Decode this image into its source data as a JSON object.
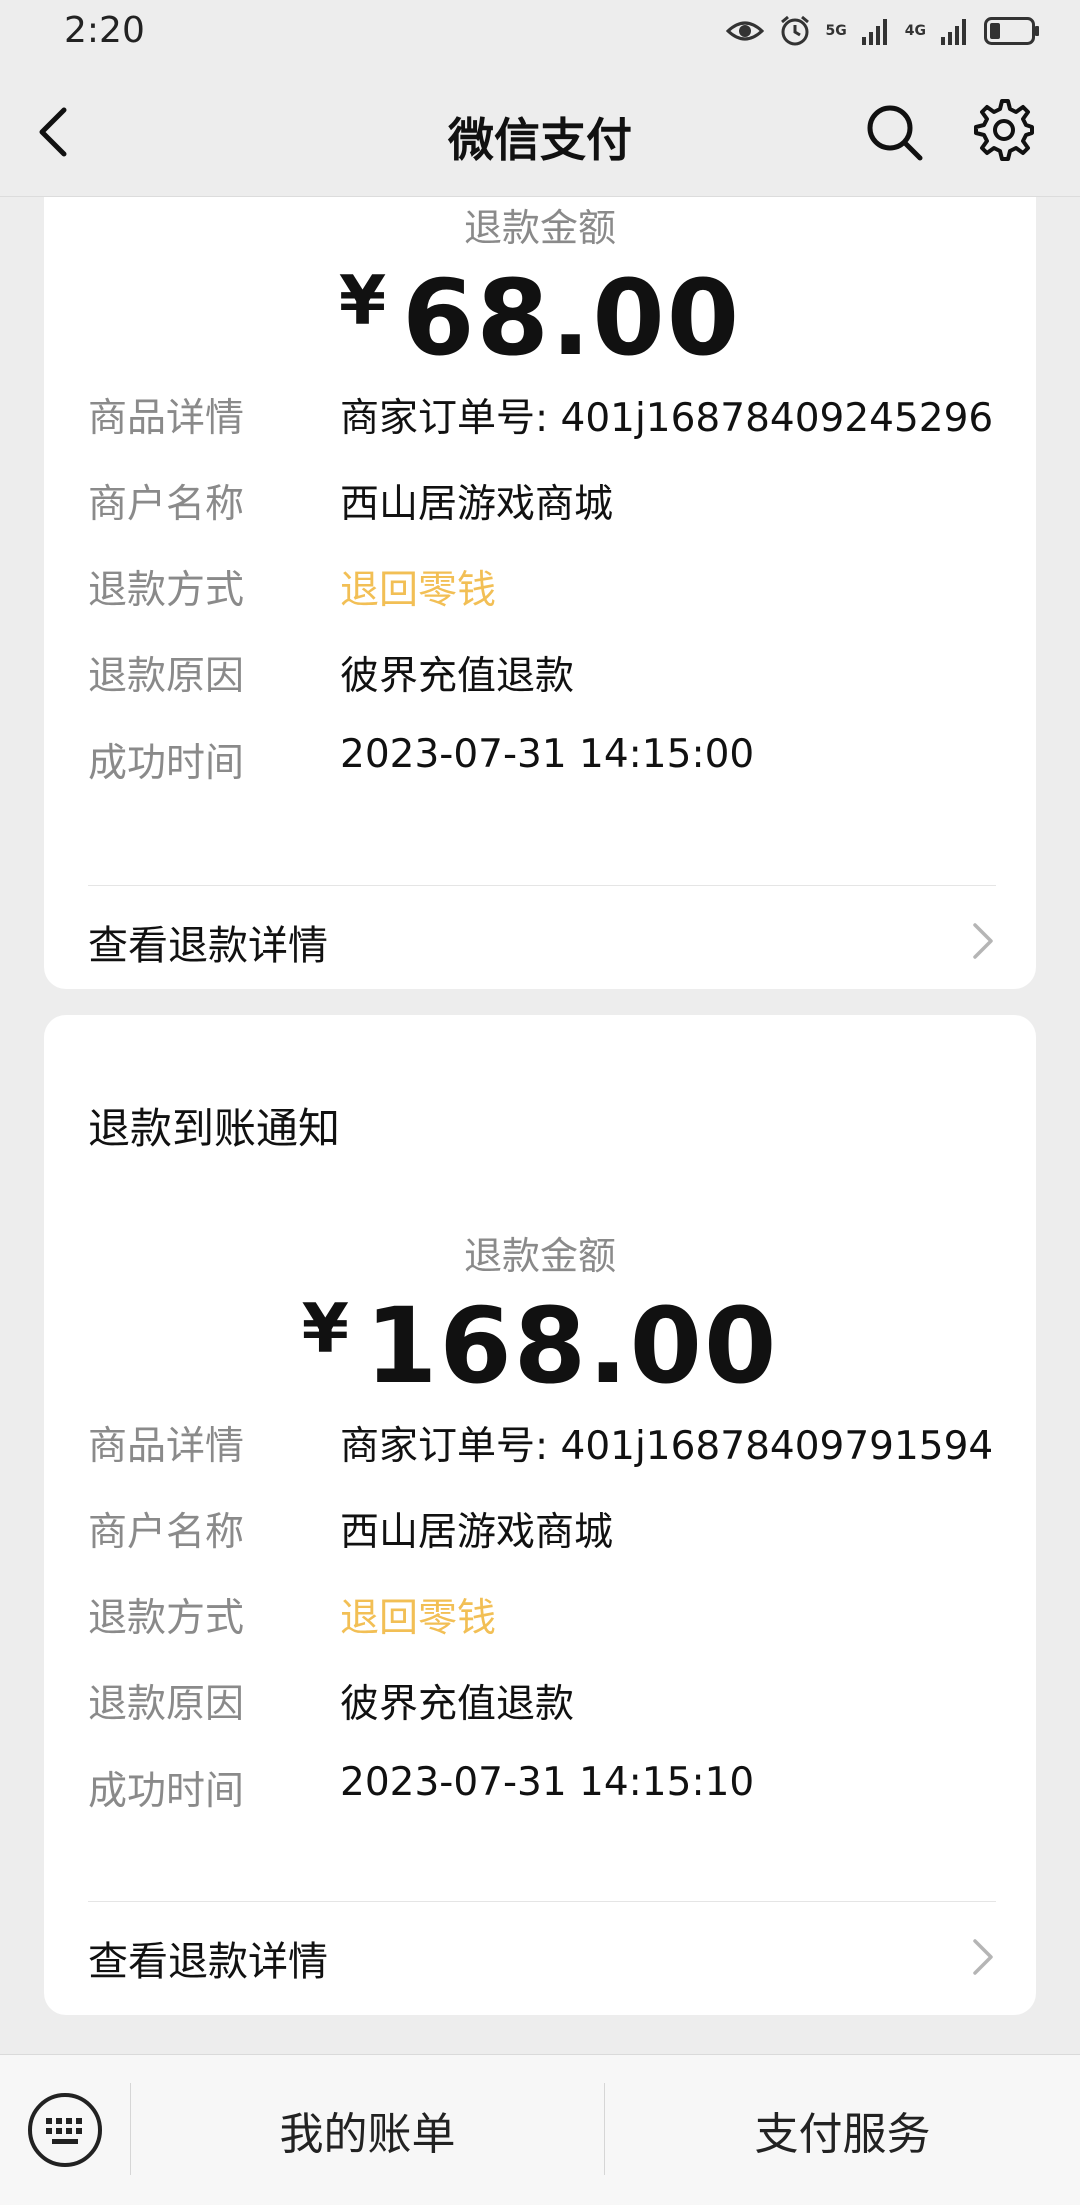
{
  "status_bar": {
    "time": "2:20",
    "network_1": "5G",
    "network_2": "4G"
  },
  "header": {
    "title": "微信支付"
  },
  "cards": [
    {
      "amount_label": "退款金额",
      "currency": "¥",
      "amount": "68.00",
      "rows": [
        {
          "label": "商品详情",
          "value": "商家订单号: 401j16878409245296"
        },
        {
          "label": "商户名称",
          "value": "西山居游戏商城"
        },
        {
          "label": "退款方式",
          "value": "退回零钱"
        },
        {
          "label": "退款原因",
          "value": "彼界充值退款"
        },
        {
          "label": "成功时间",
          "value": "2023-07-31 14:15:00"
        }
      ],
      "details_link": "查看退款详情"
    },
    {
      "title": "退款到账通知",
      "amount_label": "退款金额",
      "currency": "¥",
      "amount": "168.00",
      "rows": [
        {
          "label": "商品详情",
          "value": "商家订单号: 401j16878409791594"
        },
        {
          "label": "商户名称",
          "value": "西山居游戏商城"
        },
        {
          "label": "退款方式",
          "value": "退回零钱"
        },
        {
          "label": "退款原因",
          "value": "彼界充值退款"
        },
        {
          "label": "成功时间",
          "value": "2023-07-31 14:15:10"
        }
      ],
      "details_link": "查看退款详情"
    }
  ],
  "bottom_bar": {
    "btn_bills": "我的账单",
    "btn_services": "支付服务"
  },
  "colors": {
    "accent": "#f2bf55",
    "background": "#ededed"
  }
}
